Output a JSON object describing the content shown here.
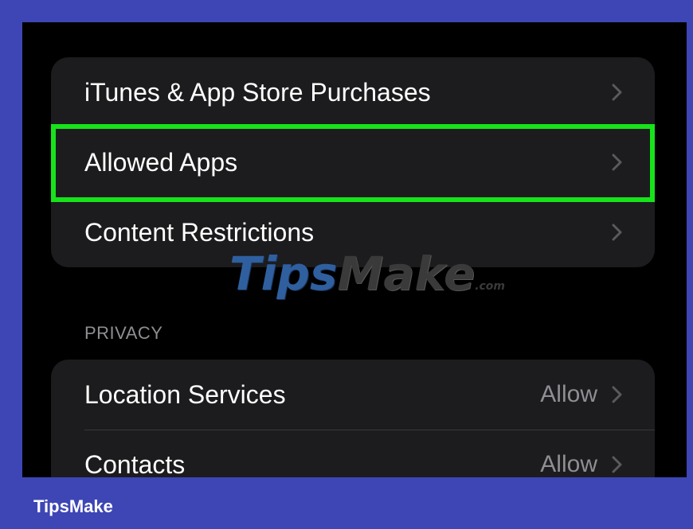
{
  "content_group": {
    "items": [
      {
        "label": "iTunes & App Store Purchases"
      },
      {
        "label": "Allowed Apps"
      },
      {
        "label": "Content Restrictions"
      }
    ]
  },
  "privacy": {
    "header": "PRIVACY",
    "items": [
      {
        "label": "Location Services",
        "value": "Allow"
      },
      {
        "label": "Contacts",
        "value": "Allow"
      }
    ]
  },
  "watermark": {
    "tips": "Tips",
    "make": "Make",
    "com": ".com"
  },
  "footer": {
    "brand": "TipsMake"
  },
  "colors": {
    "frame": "#3d46b4",
    "highlight": "#17e31a",
    "cell_bg": "#1c1c1e",
    "secondary_text": "#8e8e93"
  },
  "icons": {
    "disclosure": "chevron-right-icon"
  }
}
